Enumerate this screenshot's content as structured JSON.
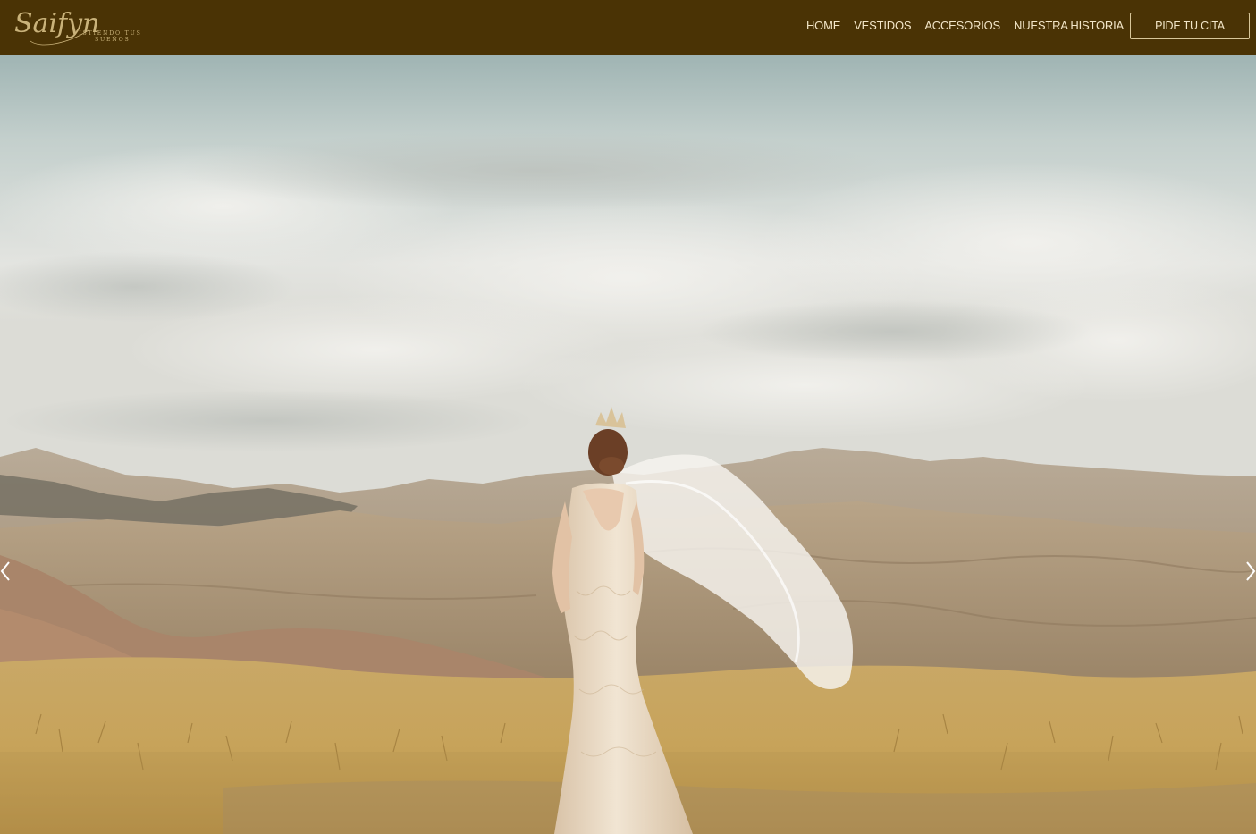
{
  "brand": {
    "logo_script": "Saifyn",
    "tagline_line1": "VISTIENDO TUS",
    "tagline_line2": "SUEÑOS"
  },
  "nav": {
    "items": [
      {
        "label": "HOME"
      },
      {
        "label": "VESTIDOS"
      },
      {
        "label": "ACCESORIOS"
      },
      {
        "label": "NUESTRA HISTORIA"
      }
    ],
    "cta_label": "PIDE TU CITA"
  },
  "hero": {
    "prev_icon": "chevron-left-icon",
    "next_icon": "chevron-right-icon"
  },
  "colors": {
    "header_bg": "#4a3305",
    "nav_text": "#f3e6c8",
    "logo_gold": "#c9b27a"
  }
}
